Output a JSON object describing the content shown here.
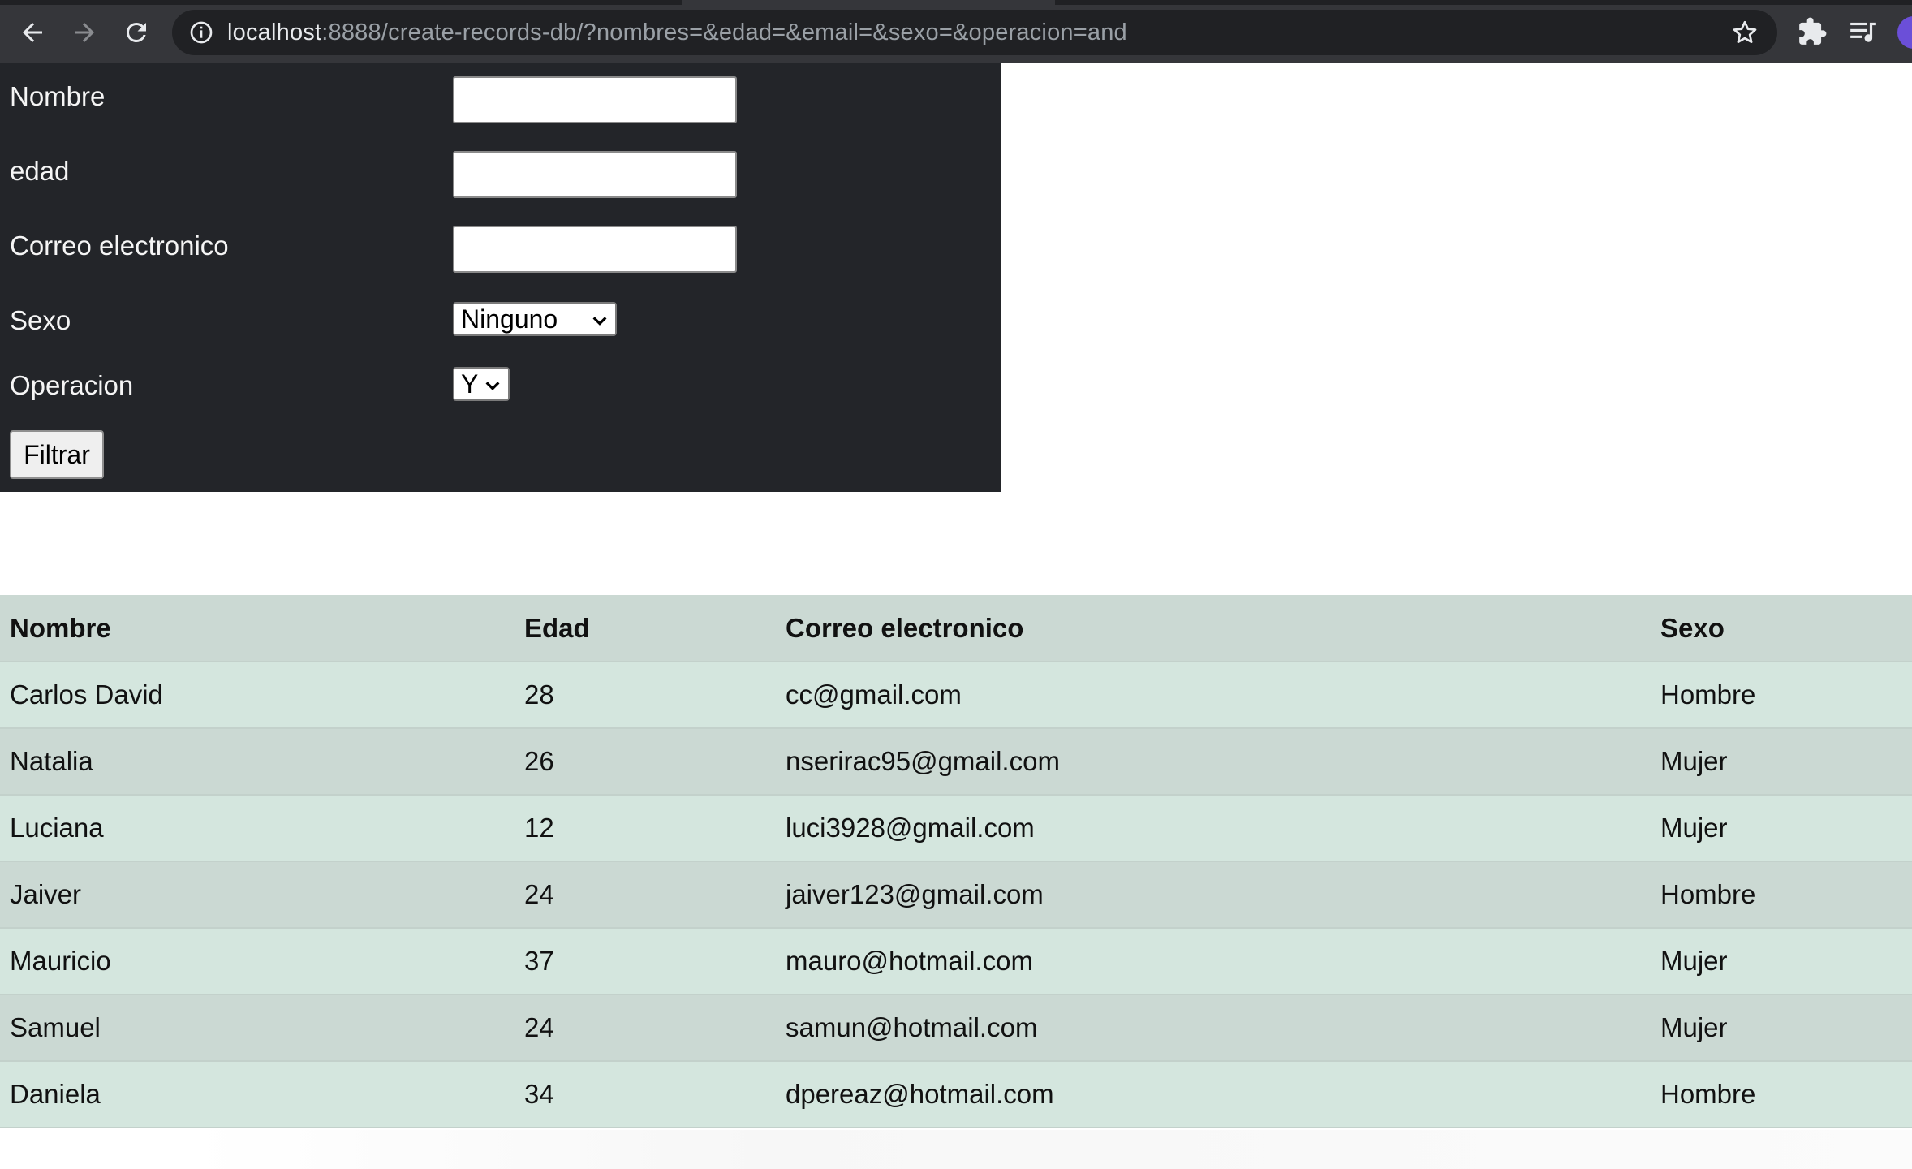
{
  "browser": {
    "url_host": "localhost",
    "url_rest": ":8888/create-records-db/?nombres=&edad=&email=&sexo=&operacion=and"
  },
  "form": {
    "nombre_label": "Nombre",
    "nombre_value": "",
    "edad_label": "edad",
    "edad_value": "",
    "email_label": "Correo electronico",
    "email_value": "",
    "sexo_label": "Sexo",
    "sexo_selected": "Ninguno",
    "operacion_label": "Operacion",
    "operacion_selected": "Y",
    "filter_button": "Filtrar"
  },
  "table": {
    "headers": [
      "Nombre",
      "Edad",
      "Correo electronico",
      "Sexo"
    ],
    "rows": [
      [
        "Carlos David",
        "28",
        "cc@gmail.com",
        "Hombre"
      ],
      [
        "Natalia",
        "26",
        "nserirac95@gmail.com",
        "Mujer"
      ],
      [
        "Luciana",
        "12",
        "luci3928@gmail.com",
        "Mujer"
      ],
      [
        "Jaiver",
        "24",
        "jaiver123@gmail.com",
        "Hombre"
      ],
      [
        "Mauricio",
        "37",
        "mauro@hotmail.com",
        "Mujer"
      ],
      [
        "Samuel",
        "24",
        "samun@hotmail.com",
        "Mujer"
      ],
      [
        "Daniela",
        "34",
        "dpereaz@hotmail.com",
        "Hombre"
      ]
    ]
  },
  "icons": {
    "back": "back-arrow-icon",
    "forward": "forward-arrow-icon",
    "reload": "reload-icon",
    "info": "info-icon",
    "bookmark": "star-icon",
    "extensions": "puzzle-icon",
    "media": "media-queue-icon",
    "profile": "profile-avatar"
  },
  "colors": {
    "toolbar": "#35363a",
    "omnibox": "#202124",
    "form_panel": "#232529",
    "table_header": "#cbd9d3",
    "row_odd": "#d4e6de",
    "row_even": "#cbd9d3",
    "profile": "#6b4fd8"
  }
}
